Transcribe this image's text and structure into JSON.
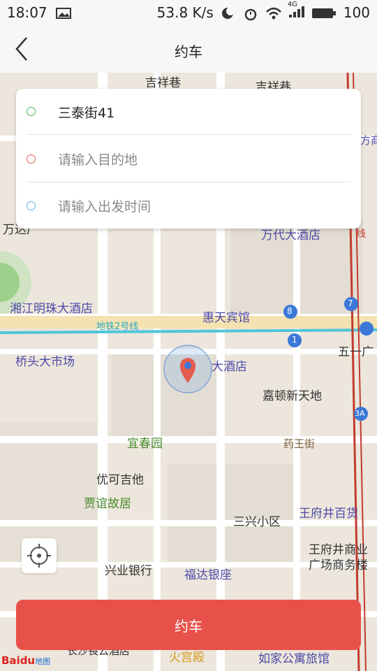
{
  "status": {
    "time": "18:07",
    "speed": "53.8 K/s",
    "network": "4G",
    "battery": "100"
  },
  "header": {
    "title": "约车"
  },
  "form": {
    "origin": "三泰街41",
    "destination_placeholder": "请输入目的地",
    "time_placeholder": "请输入出发时间",
    "origin_color": "#4caf50",
    "destination_color": "#e35d4f",
    "time_color": "#4fb3d9"
  },
  "map": {
    "labels": [
      "吉祥巷",
      "吉祥巷",
      "万达广",
      "万代大酒店",
      "湘江明珠大酒店",
      "惠天宾馆",
      "地铁2号线",
      "桥头大市场",
      "大酒店",
      "五一广",
      "嘉顿新天地",
      "宜春园",
      "药王街",
      "优可吉他",
      "贾谊故居",
      "王府井百货",
      "三兴小区",
      "王府井商业",
      "广场商务楼",
      "兴业银行",
      "福达银座",
      "长沙長云酒店",
      "火宫殿",
      "如家公寓旅馆",
      "线",
      "方商"
    ],
    "line_badges": [
      "8",
      "7",
      "1",
      "3A"
    ]
  },
  "actions": {
    "book_label": "约车"
  },
  "branding": {
    "logo_text": "Baidu",
    "logo_sub": "地图"
  },
  "colors": {
    "primary": "#e8514a",
    "metro": "#4fc6d9",
    "pin": "#e35d4f"
  }
}
